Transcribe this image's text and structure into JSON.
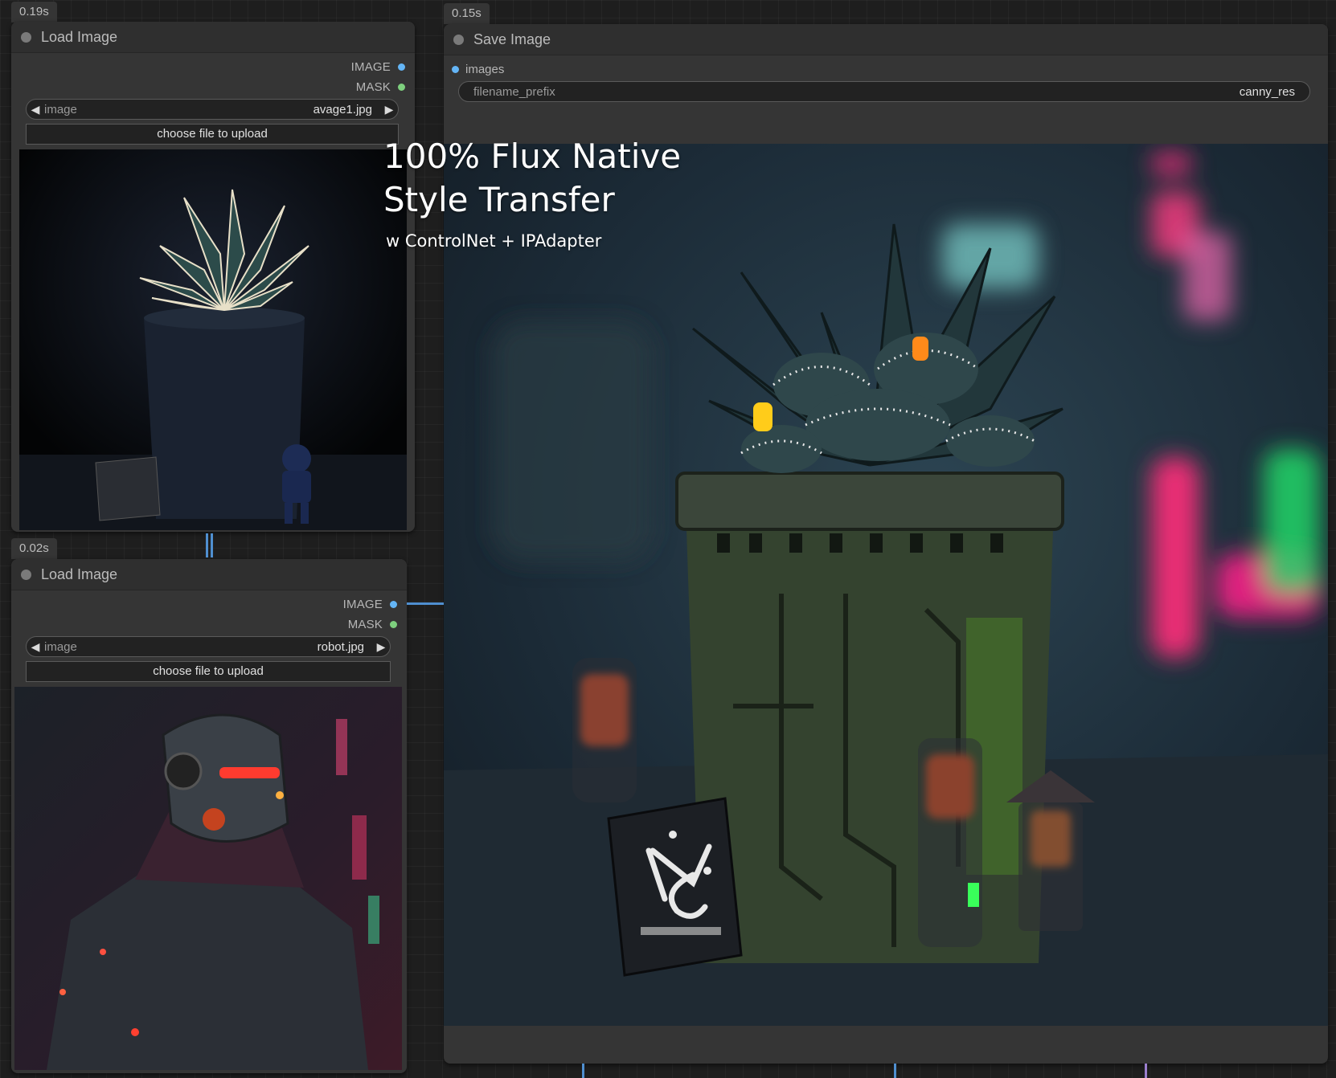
{
  "nodes": {
    "load1": {
      "time": "0.19s",
      "title": "Load Image",
      "outputs": [
        "IMAGE",
        "MASK"
      ],
      "image_label": "image",
      "image_value": "avage1.jpg",
      "upload_label": "choose file to upload"
    },
    "load2": {
      "time": "0.02s",
      "title": "Load Image",
      "outputs": [
        "IMAGE",
        "MASK"
      ],
      "image_label": "image",
      "image_value": "robot.jpg",
      "upload_label": "choose file to upload"
    },
    "save": {
      "time": "0.15s",
      "title": "Save Image",
      "input": "images",
      "prefix_label": "filename_prefix",
      "prefix_value": "canny_res"
    }
  },
  "overlay": {
    "line1": "100% Flux Native",
    "line2": "Style Transfer",
    "line3": "w ControlNet + IPAdapter"
  },
  "colors": {
    "image_socket": "#64b5f6",
    "mask_socket": "#7ed07e",
    "node_bg": "#353535"
  }
}
